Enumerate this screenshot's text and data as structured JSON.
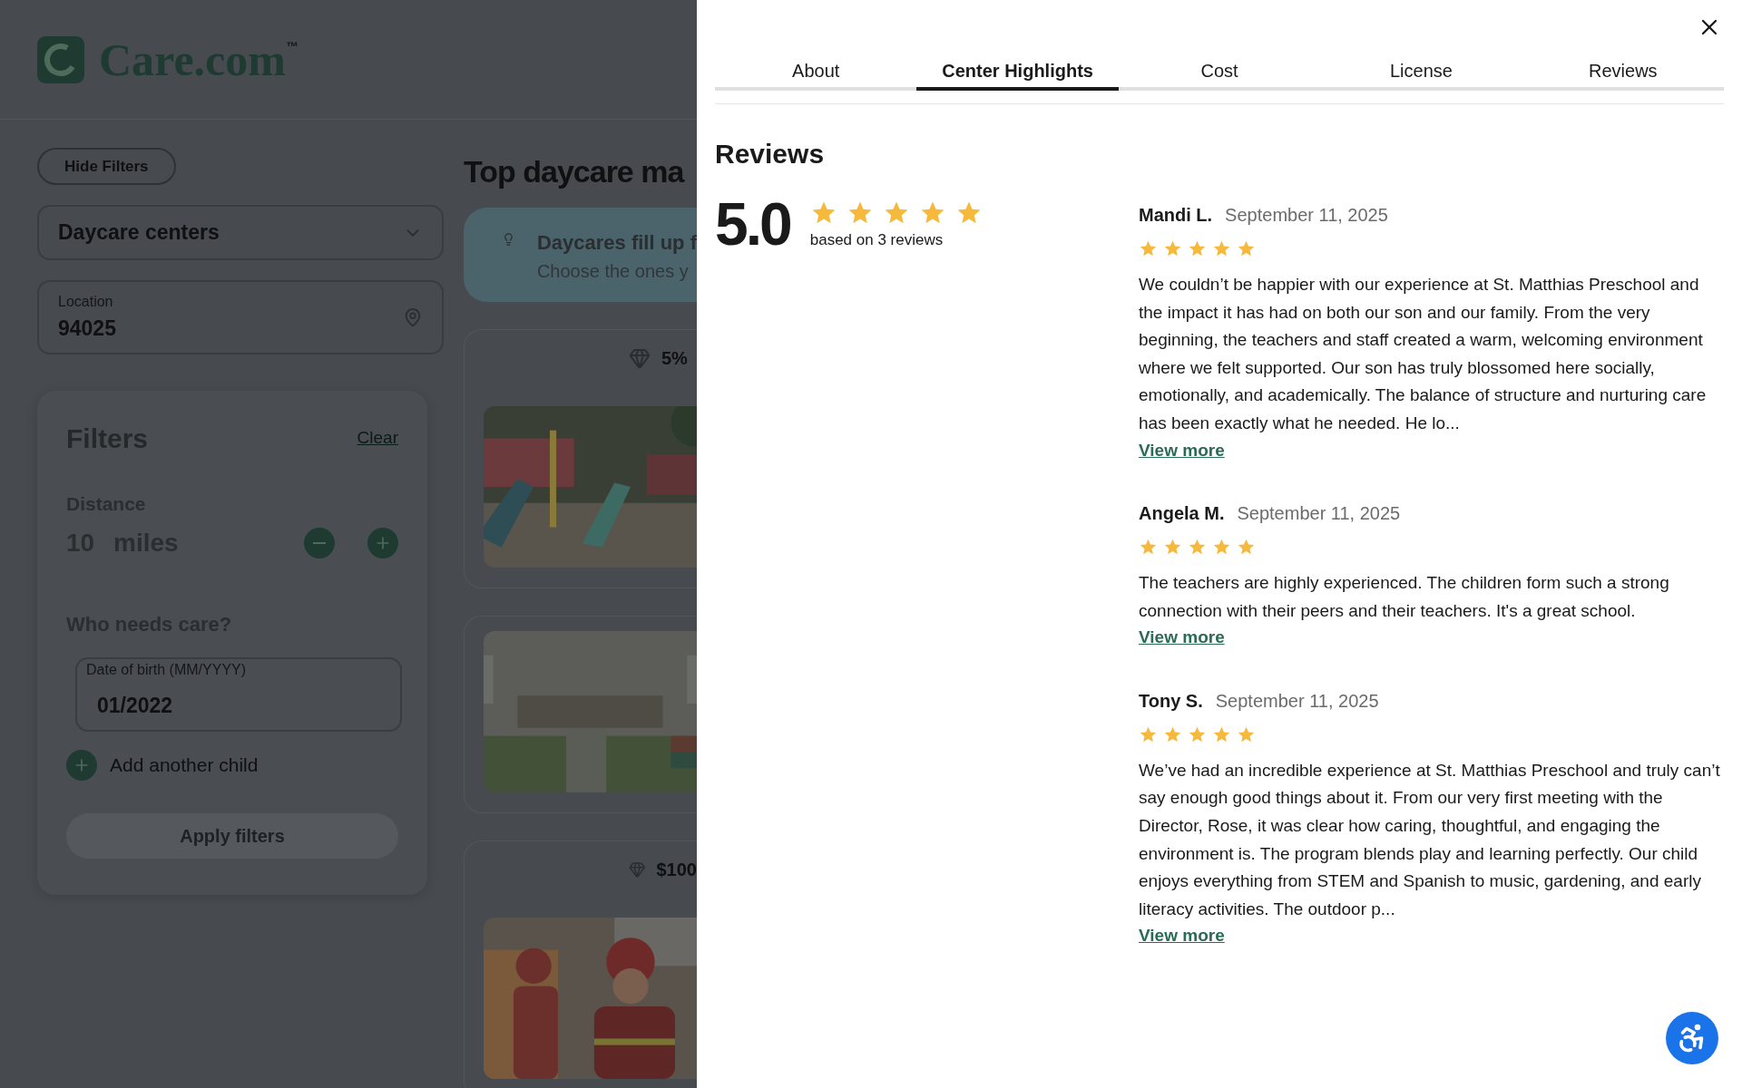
{
  "background_page": {
    "logo": {
      "text": "Care.com",
      "trademark": "™"
    },
    "hide_filters_button": "Hide Filters",
    "care_type_dropdown": {
      "value": "Daycare centers"
    },
    "location_field": {
      "label": "Location",
      "value": "94025"
    },
    "filters": {
      "title": "Filters",
      "clear_link": "Clear",
      "distance": {
        "label": "Distance",
        "value": "10",
        "unit": "miles"
      },
      "who_needs_care": "Who needs care?",
      "dob_field": {
        "label": "Date of birth (MM/YYYY)",
        "value": "01/2022"
      },
      "add_child": "Add another child",
      "apply_button": {
        "label": "Apply filters",
        "disabled": true
      }
    },
    "results": {
      "heading": "Top daycare ma",
      "banner": {
        "title": "Daycares fill up f",
        "subtitle": "Choose the ones y"
      },
      "cards": [
        {
          "badge": "5%",
          "kind": "picture"
        },
        {
          "kind": "picture"
        },
        {
          "badge": "$100",
          "kind": "picture"
        }
      ]
    }
  },
  "drawer": {
    "tabs": [
      {
        "label": "About",
        "selected": false
      },
      {
        "label": "Center Highlights",
        "selected": true
      },
      {
        "label": "Cost",
        "selected": false
      },
      {
        "label": "License",
        "selected": false
      },
      {
        "label": "Reviews",
        "selected": false
      }
    ],
    "section_title": "Reviews",
    "summary": {
      "rating": "5.0",
      "stars": 5,
      "caption": "based on 3 reviews"
    },
    "reviews": [
      {
        "name": "Mandi L.",
        "date": "September 11, 2025",
        "stars": 5,
        "text": "We couldn’t be happier with our experience at St. Matthias Preschool and the impact it has had on both our son and our family. From the very beginning, the teachers and staff created a warm, welcoming environment where we felt supported. Our son has truly blossomed here socially, emotionally, and academically. The balance of structure and nurturing care has been exactly what he needed. He lo...",
        "link": "View more"
      },
      {
        "name": "Angela M.",
        "date": "September 11, 2025",
        "stars": 5,
        "text": "The teachers are highly experienced. The children form such a strong connection with their peers and their teachers. It's a great school.",
        "link": "View more"
      },
      {
        "name": "Tony S.",
        "date": "September 11, 2025",
        "stars": 5,
        "text": "We’ve had an incredible experience at St. Matthias Preschool and truly can’t say enough good things about it. From our very first meeting with the Director, Rose, it was clear how caring, thoughtful, and engaging the environment is. The program blends play and learning perfectly. Our child enjoys everything from STEM and Spanish to music, gardening, and early literacy activities. The outdoor p...",
        "link": "View more"
      }
    ]
  }
}
